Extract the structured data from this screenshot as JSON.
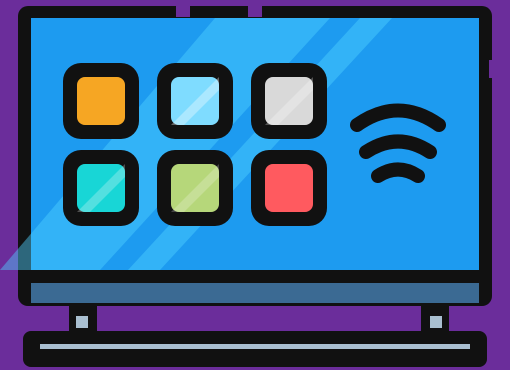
{
  "illustration": {
    "subject_icon": "smart-tv-icon",
    "colors": {
      "background": "#6b2d9b",
      "outline": "#111111",
      "screen": "#1d9bf0",
      "screen_shine": "#4fd1ff",
      "bezel_bar": "#3b6a93",
      "base_light": "#a9bfd0",
      "app_orange": "#f6a623",
      "app_sky": "#7fdcff",
      "app_gray": "#d9d9d9",
      "app_teal": "#18d6d6",
      "app_green": "#b6d77a",
      "app_red": "#ff5a5f"
    },
    "apps": [
      {
        "icon": "orange-app-tile-icon",
        "color_key": "app_orange"
      },
      {
        "icon": "sky-app-tile-icon",
        "color_key": "app_sky"
      },
      {
        "icon": "gray-app-tile-icon",
        "color_key": "app_gray"
      },
      {
        "icon": "teal-app-tile-icon",
        "color_key": "app_teal"
      },
      {
        "icon": "green-app-tile-icon",
        "color_key": "app_green"
      },
      {
        "icon": "red-app-tile-icon",
        "color_key": "app_red"
      }
    ],
    "signal": {
      "icon": "wifi-signal-icon"
    }
  }
}
